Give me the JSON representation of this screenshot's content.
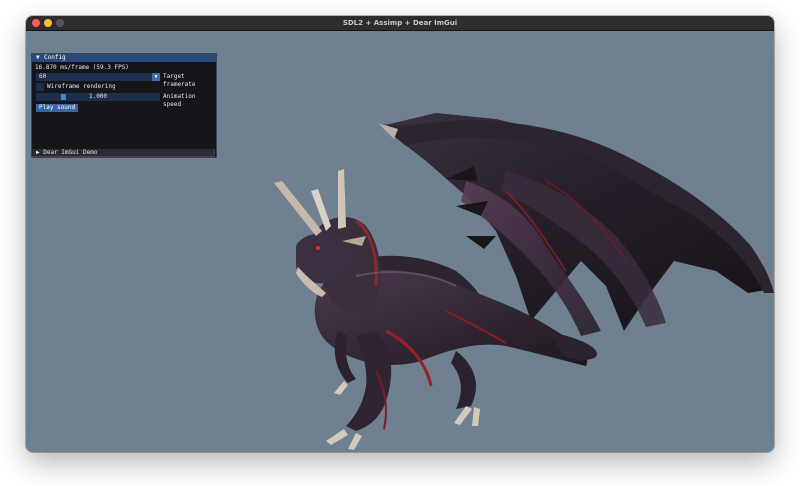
{
  "window": {
    "title": "SDL2 + Assimp + Dear ImGui"
  },
  "config_panel": {
    "title": "Config",
    "fps_text": "16.870 ms/frame (59.3 FPS)",
    "target_framerate": {
      "value": "60",
      "label": "Target framerate"
    },
    "wireframe": {
      "label": "Wireframe rendering",
      "checked": false
    },
    "animation_speed": {
      "value": "1.000",
      "label": "Animation speed"
    },
    "play_sound_label": "Play sound"
  },
  "demo_window": {
    "title": "Dear ImGui Demo"
  },
  "colors": {
    "viewport_bg": "#6f8090",
    "imgui_title": "#294a7a",
    "imgui_frame": "#1d2f4b",
    "button": "#3a63a0"
  }
}
